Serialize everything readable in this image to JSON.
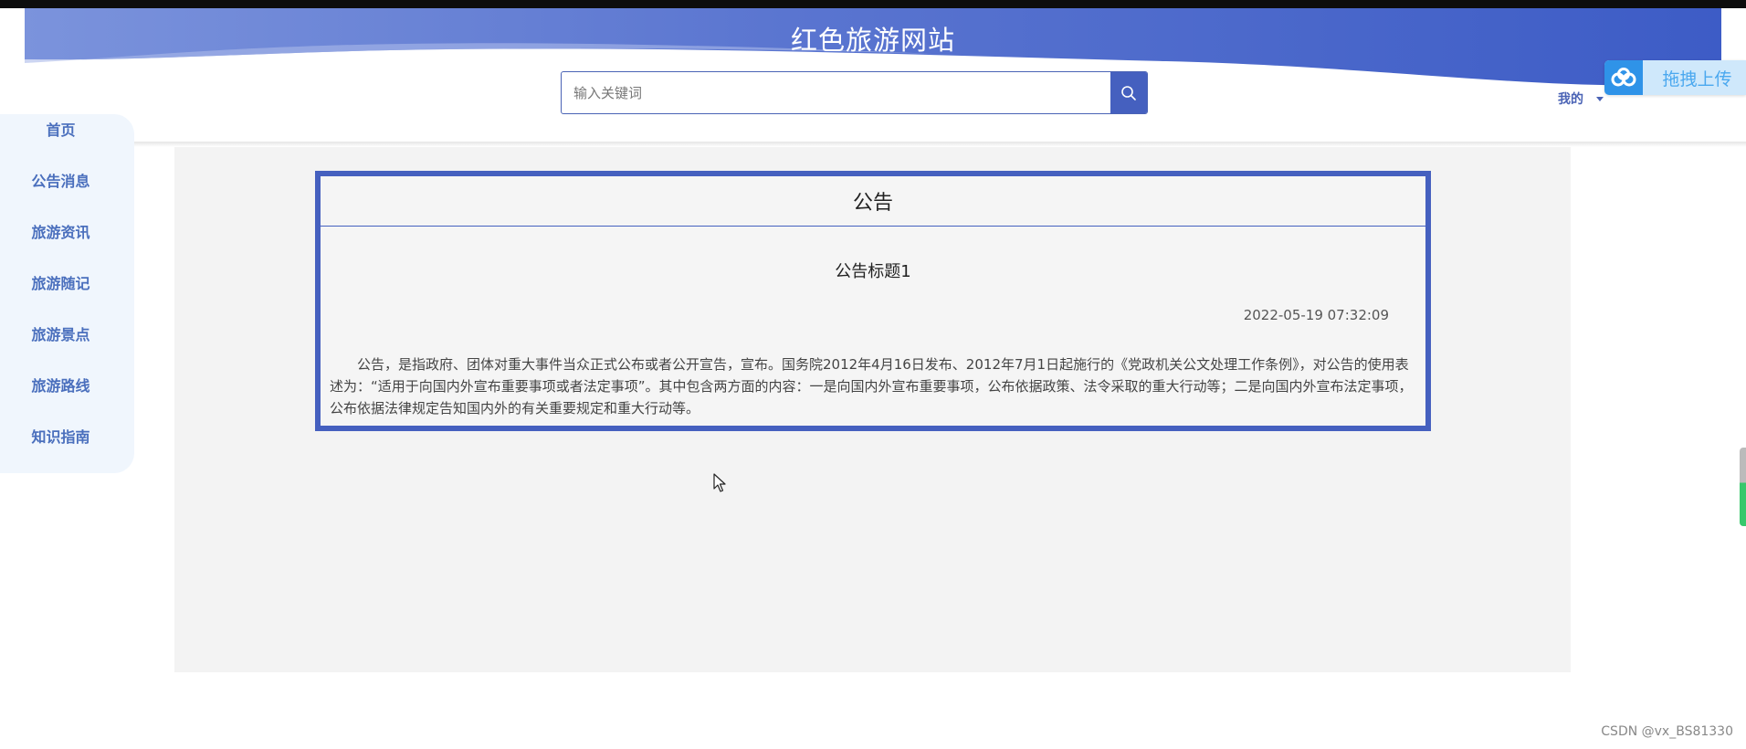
{
  "header": {
    "site_title": "红色旅游网站",
    "search_placeholder": "输入关键词",
    "user_menu_label": "我的"
  },
  "upload_widget": {
    "label": "拖拽上传"
  },
  "sidebar": {
    "items": [
      {
        "label": "首页"
      },
      {
        "label": "公告消息"
      },
      {
        "label": "旅游资讯"
      },
      {
        "label": "旅游随记"
      },
      {
        "label": "旅游景点"
      },
      {
        "label": "旅游路线"
      },
      {
        "label": "知识指南"
      }
    ]
  },
  "notice": {
    "section_title": "公告",
    "title": "公告标题1",
    "time": "2022-05-19 07:32:09",
    "body": "公告，是指政府、团体对重大事件当众正式公布或者公开宣告，宣布。国务院2012年4月16日发布、2012年7月1日起施行的《党政机关公文处理工作条例》，对公告的使用表述为：“适用于向国内外宣布重要事项或者法定事项”。其中包含两方面的内容：一是向国内外宣布重要事项，公布依据政策、法令采取的重大行动等；二是向国内外宣布法定事项，公布依据法律规定告知国内外的有关重要规定和重大行动等。"
  },
  "watermark": "CSDN @vx_BS81330",
  "colors": {
    "accent": "#4560bf",
    "nav_text": "#4a6fbd",
    "sidebar_bg": "#f0f6fd",
    "content_bg": "#f3f3f3"
  }
}
